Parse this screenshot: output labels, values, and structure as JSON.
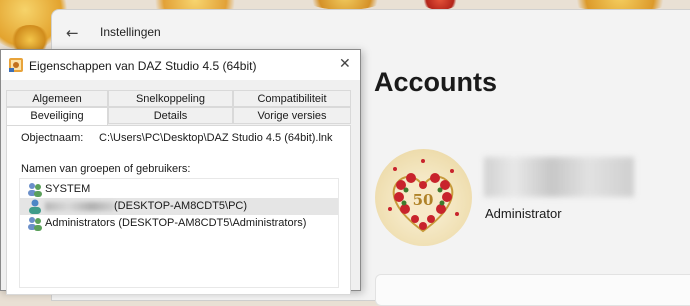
{
  "settings": {
    "app_title": "Instellingen",
    "page_heading": "Accounts",
    "account": {
      "role": "Administrator",
      "avatar_text": "50"
    }
  },
  "dialog": {
    "title": "Eigenschappen van DAZ Studio 4.5 (64bit)",
    "tabs_row1": [
      "Algemeen",
      "Snelkoppeling",
      "Compatibiliteit"
    ],
    "tabs_row2": [
      "Beveiliging",
      "Details",
      "Vorige versies"
    ],
    "active_tab": "Beveiliging",
    "object_name_label": "Objectnaam:",
    "object_name_value": "C:\\Users\\PC\\Desktop\\DAZ Studio 4.5 (64bit).lnk",
    "groups_label": "Namen van groepen of gebruikers:",
    "groups": [
      {
        "name": "SYSTEM"
      },
      {
        "name": "(DESKTOP-AM8CDT5\\PC)"
      },
      {
        "name": "Administrators (DESKTOP-AM8CDT5\\Administrators)"
      }
    ]
  },
  "icons": {
    "back": "arrow-left-icon",
    "close": "close-icon",
    "app": "daz-studio-icon",
    "user": "user-group-icon"
  },
  "colors": {
    "settings_bg": "#f3f3f3",
    "dialog_bg": "#f0f0f0",
    "selected_row": "#e5e5e5",
    "heart_red": "#c8232c",
    "gold": "#c79a3b"
  }
}
